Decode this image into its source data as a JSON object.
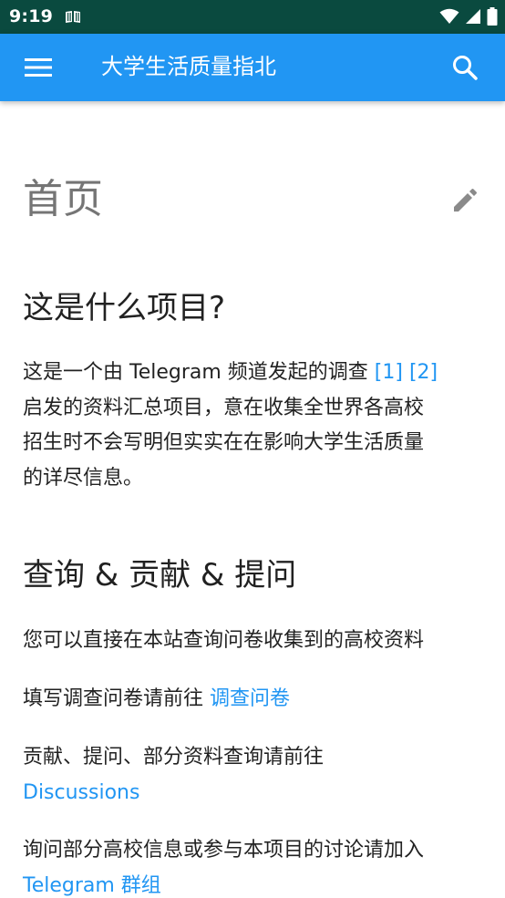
{
  "status_bar": {
    "time": "9:19",
    "icons": [
      "book-notification-icon",
      "wifi-icon",
      "signal-icon",
      "battery-icon"
    ]
  },
  "app_bar": {
    "title": "大学生活质量指北",
    "menu_icon": "hamburger-menu-icon",
    "search_icon": "search-icon",
    "color": "#2196f3"
  },
  "page": {
    "title": "首页",
    "edit_icon": "pencil-icon"
  },
  "sections": {
    "about": {
      "heading": "这是什么项目?",
      "text_before": "这是一个由 Telegram 频道发起的调查 ",
      "ref1": "[1]",
      "ref2": "[2]",
      "text_line2": "启发的资料汇总项目，意在收集全世界各高校",
      "text_line3": "招生时不会写明但实实在在影响大学生活质量",
      "text_line4": "的详尽信息。"
    },
    "query": {
      "heading": "查询 & 贡献 & 提问",
      "p1": "您可以直接在本站查询问卷收集到的高校资料",
      "p2_text": "填写调查问卷请前往 ",
      "p2_link": "调查问卷",
      "p3_text": "贡献、提问、部分资料查询请前往",
      "p3_link": "Discussions",
      "p4_text": "询问部分高校信息或参与本项目的讨论请加入",
      "p4_link": "Telegram 群组"
    }
  },
  "colors": {
    "status_bar": "#0a4a3f",
    "link": "#2196f3",
    "text": "#212121"
  }
}
